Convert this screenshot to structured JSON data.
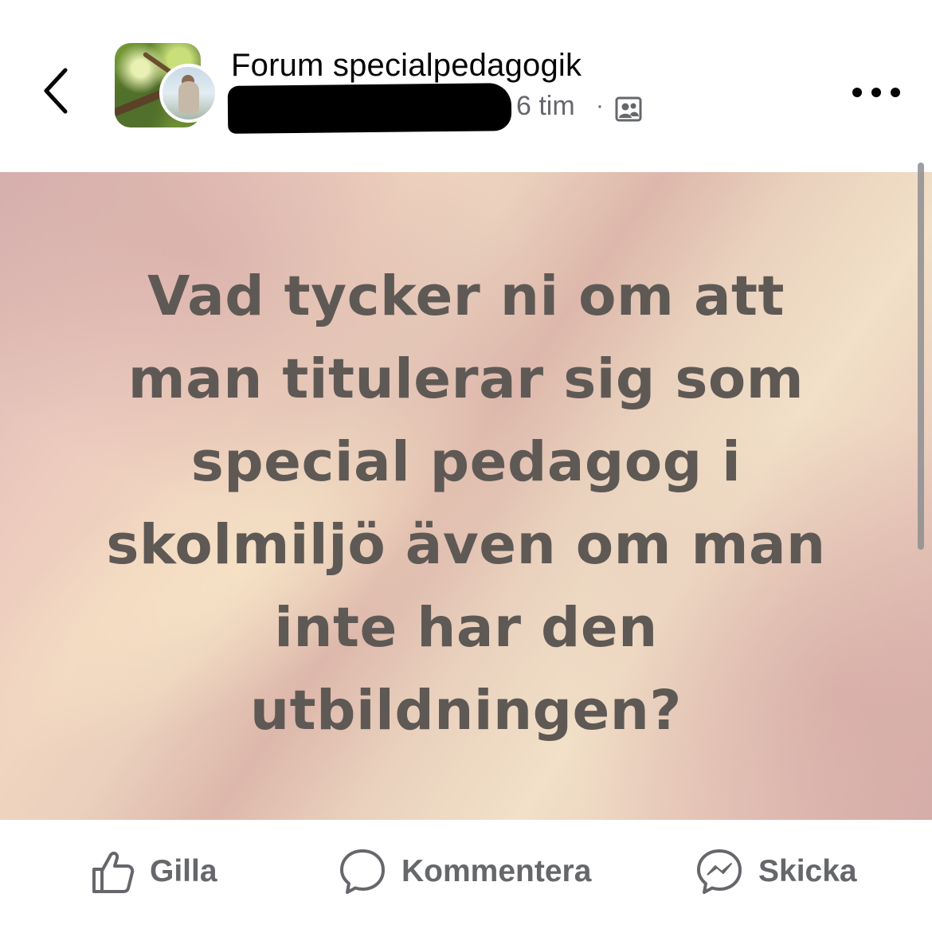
{
  "header": {
    "group_name": "Forum specialpedagogik",
    "time_ago": "6 tim",
    "separator": "·",
    "privacy_icon": "group-members-icon"
  },
  "post": {
    "lines": [
      "Vad tycker ni om att",
      "man titulerar sig som",
      "special pedagog i",
      "skolmiljö även om man",
      "inte har den",
      "utbildningen?"
    ],
    "text_color": "#5f5955"
  },
  "actions": {
    "like": {
      "label": "Gilla",
      "icon": "thumbs-up-icon"
    },
    "comment": {
      "label": "Kommentera",
      "icon": "comment-bubble-icon"
    },
    "share": {
      "label": "Skicka",
      "icon": "messenger-icon"
    }
  },
  "colors": {
    "primary_text": "#050505",
    "secondary_text": "#65676b",
    "background": "#ffffff"
  }
}
